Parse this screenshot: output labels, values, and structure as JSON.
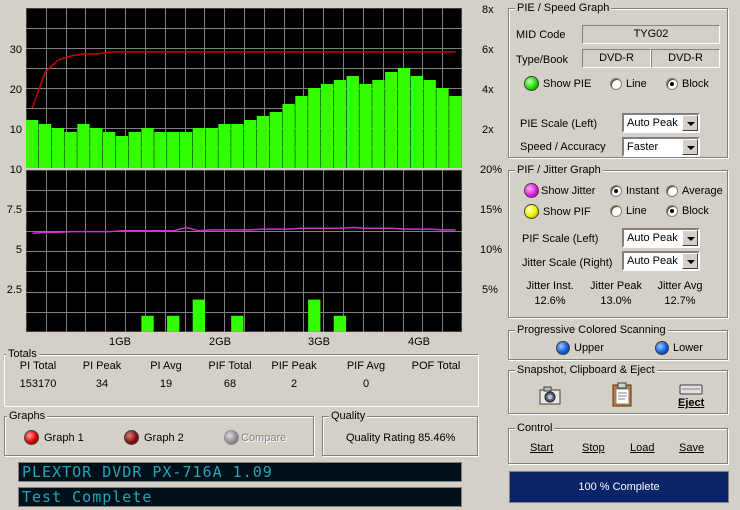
{
  "charts": {
    "top_axis_left": [
      "30",
      "20",
      "10"
    ],
    "top_axis_right": [
      "8x",
      "6x",
      "4x",
      "2x"
    ],
    "bottom_axis_left": [
      "10",
      "7.5",
      "5",
      "2.5"
    ],
    "bottom_axis_right": [
      "20%",
      "15%",
      "10%",
      "5%"
    ],
    "x_labels": [
      "1GB",
      "2GB",
      "3GB",
      "4GB"
    ],
    "colors": {
      "pie": "#33ff00",
      "speed": "#cc0000",
      "jitter": "#cc33cc",
      "pif": "#33ff00",
      "background": "#000000",
      "grid": "#808080"
    }
  },
  "chart_data": [
    {
      "type": "bar",
      "title": "",
      "x_labels": [
        "1GB",
        "2GB",
        "3GB",
        "4GB"
      ],
      "y_ticks_left": [
        "30",
        "20",
        "10"
      ],
      "y_ticks_right": [
        "8x",
        "6x",
        "4x",
        "2x"
      ],
      "ylim_left": [
        0,
        40
      ],
      "ylim_right": [
        0,
        8
      ],
      "series": [
        {
          "name": "PIE",
          "type": "bar",
          "color": "#33ff00",
          "values": [
            12,
            11,
            10,
            9,
            11,
            10,
            9,
            8,
            9,
            10,
            9,
            9,
            9,
            10,
            10,
            11,
            11,
            12,
            13,
            14,
            16,
            18,
            20,
            21,
            22,
            23,
            21,
            22,
            24,
            25,
            23,
            22,
            20,
            18
          ]
        },
        {
          "name": "Speed",
          "type": "line",
          "color": "#cc0000",
          "values": [
            3.0,
            4.8,
            5.4,
            5.6,
            5.7,
            5.7,
            5.8,
            5.8,
            5.8,
            5.8,
            5.8,
            5.8,
            5.8,
            5.8,
            5.8,
            5.8,
            5.8,
            5.8,
            5.8,
            5.8,
            5.8,
            5.8,
            5.8,
            5.8,
            5.8,
            5.8,
            5.8,
            5.8,
            5.8,
            5.8,
            5.8,
            5.8,
            5.8,
            5.8
          ]
        }
      ]
    },
    {
      "type": "bar",
      "title": "",
      "x_labels": [
        "1GB",
        "2GB",
        "3GB",
        "4GB"
      ],
      "y_ticks_left": [
        "10",
        "7.5",
        "5",
        "2.5"
      ],
      "y_ticks_right": [
        "20%",
        "15%",
        "10%",
        "5%"
      ],
      "ylim_left": [
        0,
        10
      ],
      "ylim_right": [
        0,
        20
      ],
      "series": [
        {
          "name": "PIF",
          "type": "bar",
          "color": "#33ff00",
          "values": [
            0,
            0,
            0,
            0,
            0,
            0,
            0,
            0,
            0,
            1,
            0,
            1,
            0,
            2,
            0,
            0,
            1,
            0,
            0,
            0,
            0,
            0,
            2,
            0,
            1,
            0,
            0,
            0,
            0,
            0,
            0,
            0,
            0,
            0
          ]
        },
        {
          "name": "Jitter",
          "type": "line",
          "color": "#cc33cc",
          "values": [
            12.2,
            12.3,
            12.3,
            12.4,
            12.4,
            12.4,
            12.4,
            12.5,
            12.5,
            12.5,
            12.5,
            12.5,
            12.9,
            12.5,
            12.6,
            12.6,
            12.6,
            12.6,
            12.7,
            12.7,
            12.7,
            12.8,
            12.8,
            12.8,
            12.8,
            12.9,
            12.8,
            12.8,
            12.8,
            12.7,
            12.7,
            12.7,
            12.6,
            12.6
          ]
        }
      ]
    }
  ],
  "pie_speed": {
    "title": "PIE / Speed Graph",
    "mid_code_label": "MID Code",
    "mid_code_value": "TYG02",
    "type_book_label": "Type/Book",
    "type_value": "DVD-R",
    "book_value": "DVD-R",
    "show_pie": "Show PIE",
    "line": "Line",
    "block": "Block",
    "pie_scale_label": "PIE Scale (Left)",
    "pie_scale_value": "Auto Peak",
    "speed_label": "Speed / Accuracy",
    "speed_value": "Faster"
  },
  "pif_jitter": {
    "title": "PIF / Jitter Graph",
    "show_jitter": "Show Jitter",
    "instant": "Instant",
    "average": "Average",
    "show_pif": "Show PIF",
    "line": "Line",
    "block": "Block",
    "pif_scale_label": "PIF Scale (Left)",
    "pif_scale_value": "Auto Peak",
    "jitter_scale_label": "Jitter Scale (Right)",
    "jitter_scale_value": "Auto Peak",
    "jitter_inst_label": "Jitter Inst.",
    "jitter_inst_value": "12.6%",
    "jitter_peak_label": "Jitter Peak",
    "jitter_peak_value": "13.0%",
    "jitter_avg_label": "Jitter Avg",
    "jitter_avg_value": "12.7%"
  },
  "scanning": {
    "title": "Progressive Colored Scanning",
    "upper": "Upper",
    "lower": "Lower"
  },
  "snapshot": {
    "title": "Snapshot,  Clipboard  & Eject",
    "eject": "Eject"
  },
  "control": {
    "title": "Control",
    "start": "Start",
    "stop": "Stop",
    "load": "Load",
    "save": "Save"
  },
  "progress": {
    "text": "100 % Complete",
    "fraction": 1.0
  },
  "totals": {
    "title": "Totals",
    "headers": [
      "PI Total",
      "PI Peak",
      "PI Avg",
      "PIF Total",
      "PIF Peak",
      "PIF Avg",
      "POF Total"
    ],
    "values": [
      "153170",
      "34",
      "19",
      "68",
      "2",
      "0",
      ""
    ]
  },
  "graphs": {
    "title": "Graphs",
    "graph1": "Graph 1",
    "graph2": "Graph 2",
    "compare": "Compare"
  },
  "quality": {
    "title": "Quality",
    "rating": "Quality Rating 85.46%"
  },
  "status": {
    "drive": "PLEXTOR DVDR   PX-716A 1.09",
    "message": "Test Complete"
  }
}
